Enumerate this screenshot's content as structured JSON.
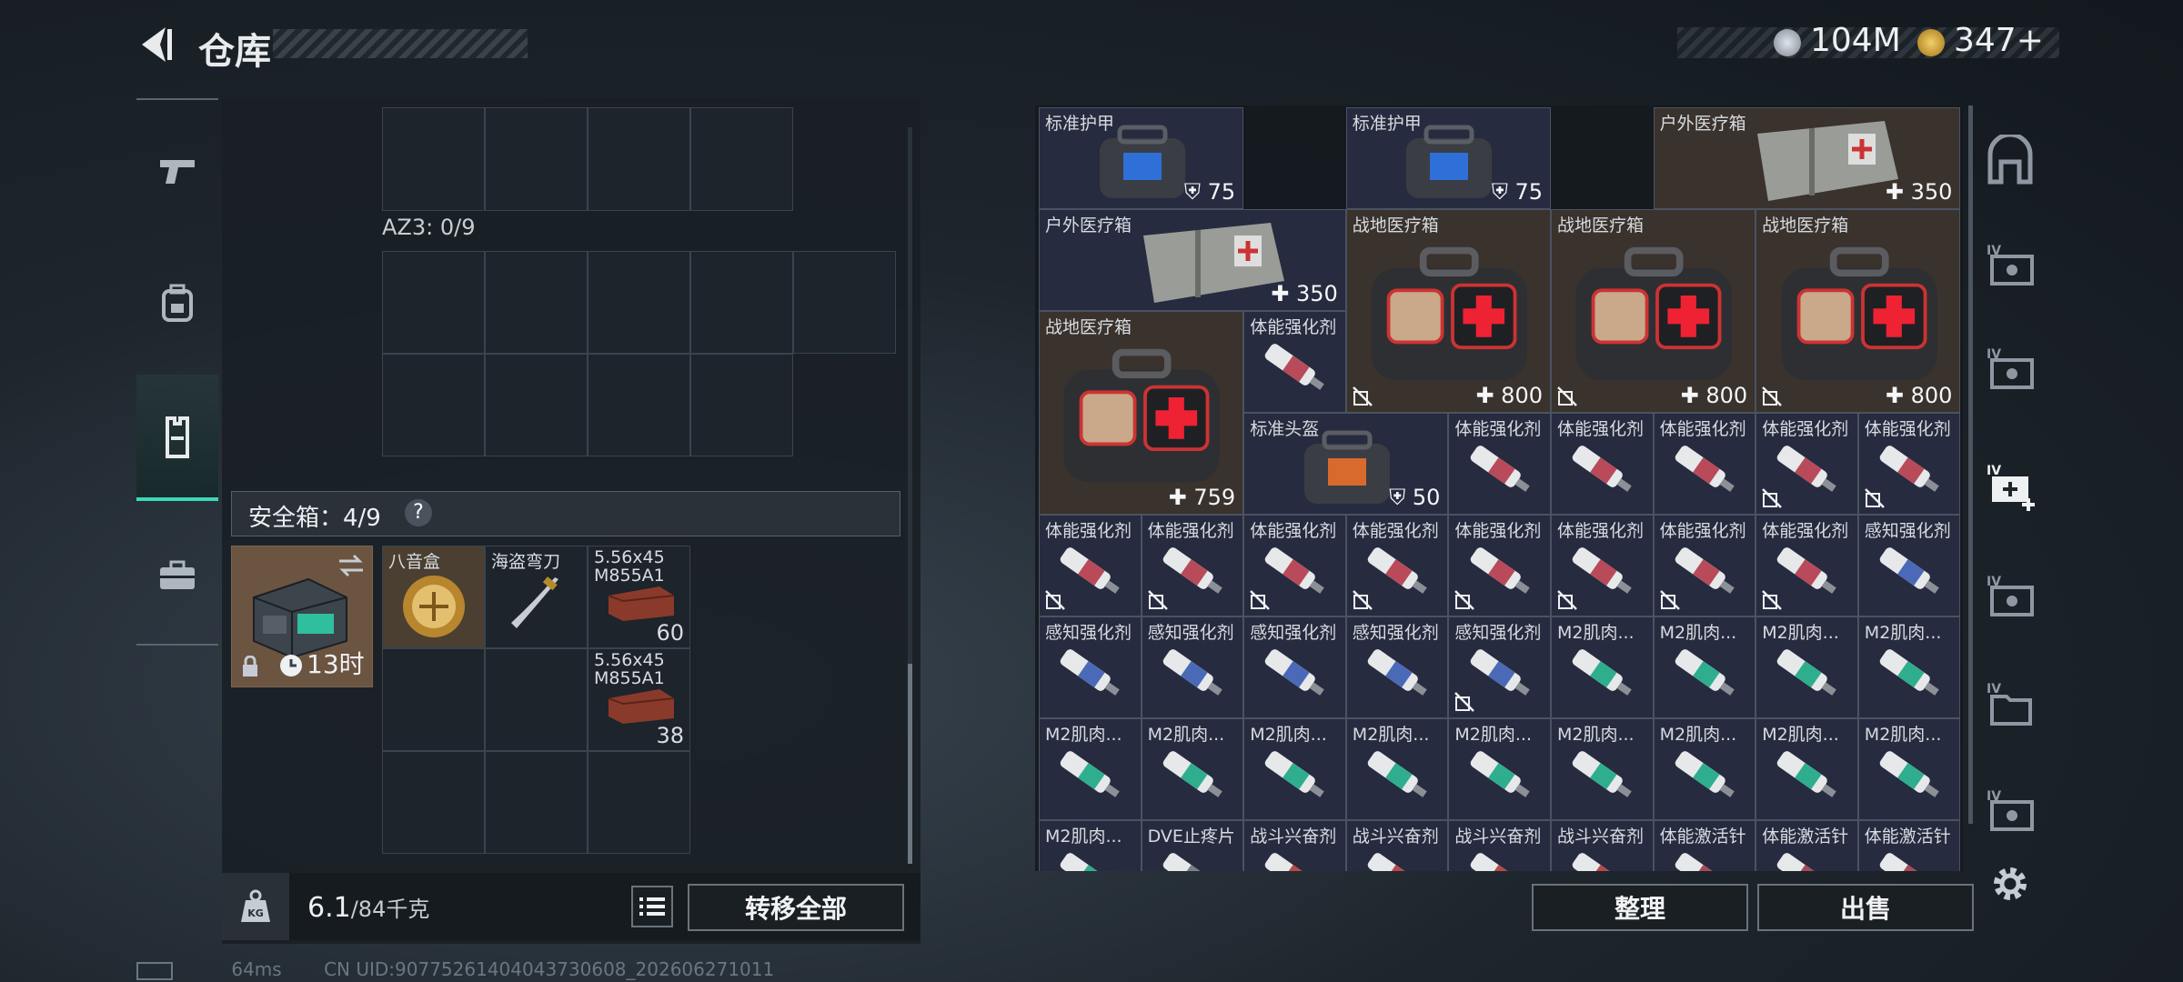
{
  "header": {
    "title": "仓库"
  },
  "currency": [
    {
      "name": "coin-silver",
      "value": "104M",
      "color": "#b9c2cc"
    },
    {
      "name": "coin-gold",
      "value": "347+",
      "color": "#d9a93a"
    }
  ],
  "left_tabs": [
    {
      "icon": "pistol-icon",
      "active": false
    },
    {
      "icon": "backpack-icon",
      "active": false
    },
    {
      "icon": "vest-icon",
      "active": true
    },
    {
      "icon": "briefcase-icon",
      "active": false
    }
  ],
  "az3": {
    "label": "AZ3: 0/9"
  },
  "safebox": {
    "label": "安全箱：4/9",
    "help": "?",
    "timer": "13时",
    "items": [
      {
        "name": "八音盒"
      },
      {
        "name": "海盗弯刀"
      },
      {
        "name": "5.56x45\nM855A1",
        "count": "60"
      },
      {
        "name": "5.56x45\nM855A1",
        "count": "38"
      }
    ]
  },
  "weight": {
    "value": "6.1",
    "max": "/84千克"
  },
  "buttons": {
    "transfer_all": "转移全部",
    "sort": "整理",
    "sell": "出售"
  },
  "stash_items": [
    {
      "name": "标准护甲",
      "value": "75",
      "badge": "shield"
    },
    {
      "name": "标准护甲",
      "value": "75",
      "badge": "shield"
    },
    {
      "name": "户外医疗箱",
      "value": "350",
      "badge": "plus"
    },
    {
      "name": "户外医疗箱",
      "value": "350",
      "badge": "plus"
    },
    {
      "name": "战地医疗箱",
      "value": "800",
      "badge": "plus",
      "no_trade": true
    },
    {
      "name": "战地医疗箱",
      "value": "800",
      "badge": "plus",
      "no_trade": true
    },
    {
      "name": "战地医疗箱",
      "value": "800",
      "badge": "plus",
      "no_trade": true
    },
    {
      "name": "战地医疗箱",
      "value": "759",
      "badge": "plus"
    },
    {
      "name": "体能强化剂"
    },
    {
      "name": "标准头盔",
      "value": "50",
      "badge": "shield"
    },
    {
      "name": "体能强化剂"
    },
    {
      "name": "体能强化剂"
    },
    {
      "name": "体能强化剂"
    },
    {
      "name": "体能强化剂",
      "no_trade": true
    },
    {
      "name": "体能强化剂",
      "no_trade": true
    },
    {
      "name": "体能强化剂",
      "no_trade": true
    },
    {
      "name": "体能强化剂",
      "no_trade": true
    },
    {
      "name": "体能强化剂",
      "no_trade": true
    },
    {
      "name": "体能强化剂",
      "no_trade": true
    },
    {
      "name": "体能强化剂",
      "no_trade": true
    },
    {
      "name": "体能强化剂",
      "no_trade": true
    },
    {
      "name": "体能强化剂",
      "no_trade": true
    },
    {
      "name": "体能强化剂",
      "no_trade": true
    },
    {
      "name": "感知强化剂"
    },
    {
      "name": "感知强化剂"
    },
    {
      "name": "感知强化剂"
    },
    {
      "name": "感知强化剂"
    },
    {
      "name": "感知强化剂"
    },
    {
      "name": "感知强化剂",
      "no_trade": true
    },
    {
      "name": "M2肌肉..."
    },
    {
      "name": "M2肌肉..."
    },
    {
      "name": "M2肌肉..."
    },
    {
      "name": "M2肌肉..."
    },
    {
      "name": "M2肌肉..."
    },
    {
      "name": "M2肌肉..."
    },
    {
      "name": "M2肌肉..."
    },
    {
      "name": "M2肌肉..."
    },
    {
      "name": "M2肌肉..."
    },
    {
      "name": "M2肌肉..."
    },
    {
      "name": "M2肌肉..."
    },
    {
      "name": "M2肌肉..."
    },
    {
      "name": "M2肌肉..."
    },
    {
      "name": "M2肌肉..."
    },
    {
      "name": "DVE止疼片"
    },
    {
      "name": "战斗兴奋剂"
    },
    {
      "name": "战斗兴奋剂"
    },
    {
      "name": "战斗兴奋剂"
    },
    {
      "name": "战斗兴奋剂"
    },
    {
      "name": "体能激活针"
    },
    {
      "name": "体能激活针"
    },
    {
      "name": "体能激活针"
    }
  ],
  "right_side_icons": [
    "safe-room-icon",
    "tier4-case-icon",
    "tier4-case-icon",
    "tier4-medkit-add-icon",
    "tier4-case-icon",
    "tier4-folder-icon",
    "tier4-case-icon"
  ],
  "status": {
    "ping": "64ms",
    "uid": "CN UID:90775261404043730608_202606271011"
  }
}
